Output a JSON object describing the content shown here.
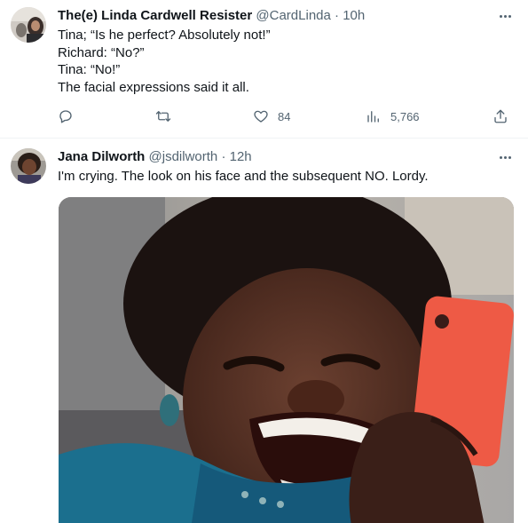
{
  "tweet1": {
    "display_name": "The(e) Linda Cardwell Resister",
    "handle": "@CardLinda",
    "separator": "·",
    "time": "10h",
    "lines": [
      "Tina; “Is he perfect? Absolutely not!”",
      "Richard: “No?”",
      "Tina: “No!”",
      "The facial expressions said it all."
    ],
    "actions": {
      "reply_icon": "reply-icon",
      "retweet_icon": "retweet-icon",
      "like_icon": "heart-icon",
      "like_count": "84",
      "views_icon": "views-icon",
      "views_count": "5,766",
      "share_icon": "share-icon"
    }
  },
  "tweet2": {
    "display_name": "Jana Dilworth",
    "handle": "@jsdilworth",
    "separator": "·",
    "time": "12h",
    "text": "I'm crying. The look on his face and the subsequent NO. Lordy."
  },
  "colors": {
    "text_primary": "#0f1419",
    "text_secondary": "#536471",
    "divider": "#eff3f4"
  }
}
